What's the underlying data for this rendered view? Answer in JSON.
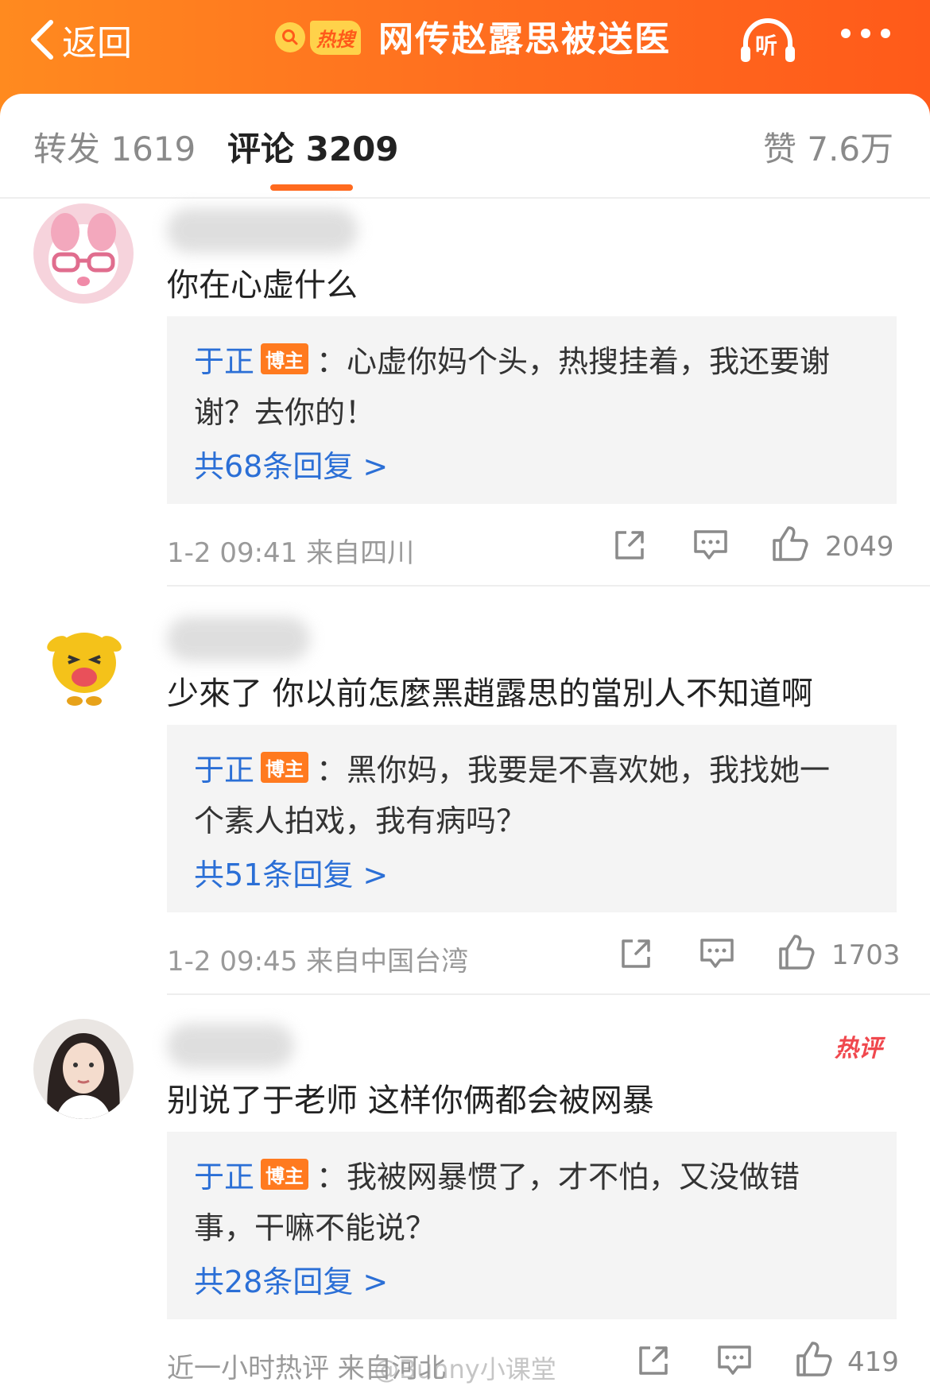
{
  "header": {
    "back_label": "返回",
    "hot_label": "热搜",
    "title": "网传赵露思被送医",
    "listen_label": "听"
  },
  "tabs": [
    {
      "label": "转发 1619"
    },
    {
      "label": "评论 3209"
    },
    {
      "label": "赞 7.6万"
    }
  ],
  "comments": [
    {
      "text": "你在心虚什么",
      "reply": {
        "author": "于正",
        "badge": "博主",
        "line1": "：心虚你妈个头，热搜挂着，我还要谢",
        "line2": "谢？去你的！",
        "more": "共68条回复 >"
      },
      "meta": "1-2 09:41  来自四川",
      "likes": "2049"
    },
    {
      "text": "少來了 你以前怎麼黑趙露思的當別人不知道啊",
      "reply": {
        "author": "于正",
        "badge": "博主",
        "line1": "：黑你妈，我要是不喜欢她，我找她一",
        "line2": "个素人拍戏，我有病吗？",
        "more": "共51条回复 >"
      },
      "meta": "1-2 09:45  来自中国台湾",
      "likes": "1703"
    },
    {
      "hot_tag": "热评",
      "text": "别说了于老师 这样你俩都会被网暴",
      "reply": {
        "author": "于正",
        "badge": "博主",
        "line1": "：我被网暴惯了，才不怕，又没做错",
        "line2": "事，干嘛不能说？",
        "more": "共28条回复 >"
      },
      "meta": "近一小时热评  来自河北",
      "likes": "419"
    }
  ],
  "watermark": "@Bunny小课堂",
  "colors": {
    "header_orange": "#ff6f1f",
    "link_blue": "#2b6fd6",
    "badge_orange": "#ff7a1f",
    "hot_red": "#f0484e"
  }
}
